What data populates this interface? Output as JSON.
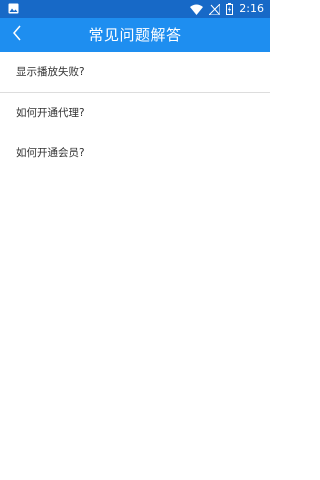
{
  "status_bar": {
    "time": "2:16",
    "icons": [
      "image-icon",
      "wifi-icon",
      "no-signal-icon",
      "battery-charging-icon"
    ]
  },
  "app_bar": {
    "title": "常见问题解答",
    "back_icon": "chevron-left-icon",
    "color": "#1e8ef0"
  },
  "faq": {
    "items": [
      {
        "label": "显示播放失败?"
      },
      {
        "label": "如何开通代理?"
      },
      {
        "label": "如何开通会员?"
      }
    ]
  }
}
